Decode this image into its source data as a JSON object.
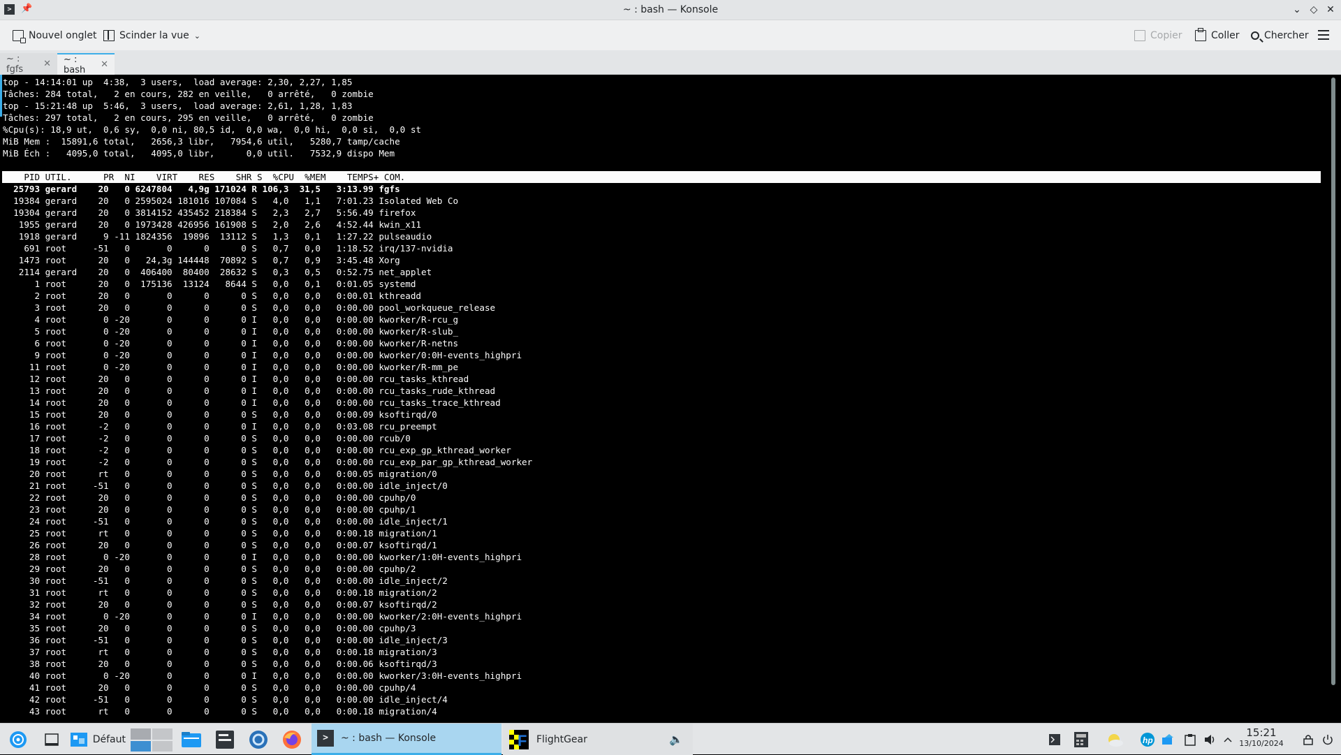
{
  "window": {
    "title": "~ : bash — Konsole",
    "title_icon": "terminal-icon",
    "buttons": [
      "minimize",
      "maximize",
      "close"
    ]
  },
  "toolbar": {
    "new_tab": "Nouvel onglet",
    "split_view": "Scinder la vue",
    "copy": "Copier",
    "paste": "Coller",
    "search": "Chercher",
    "menu_icon": "hamburger-menu-icon"
  },
  "tabs": [
    {
      "label": "~ : fgfs",
      "active": false
    },
    {
      "label": "~ : bash",
      "active": true
    }
  ],
  "terminal": {
    "summary": [
      "top - 14:14:01 up  4:38,  3 users,  load average: 2,30, 2,27, 1,85",
      "Tâches: 284 total,   2 en cours, 282 en veille,   0 arrêté,   0 zombie",
      "top - 15:21:48 up  5:46,  3 users,  load average: 2,61, 1,28, 1,83",
      "Tâches: 297 total,   2 en cours, 295 en veille,   0 arrêté,   0 zombie",
      "%Cpu(s): 18,9 ut,  0,6 sy,  0,0 ni, 80,5 id,  0,0 wa,  0,0 hi,  0,0 si,  0,0 st",
      "MiB Mem :  15891,6 total,   2656,3 libr,   7954,6 util,   5280,7 tamp/cache",
      "MiB Éch :   4095,0 total,   4095,0 libr,      0,0 util.   7532,9 dispo Mem",
      ""
    ],
    "header": "    PID UTIL.      PR  NI    VIRT    RES    SHR S  %CPU  %MEM    TEMPS+ COM.",
    "processes": [
      "  25793 gerard    20   0 6247804   4,9g 171024 R 106,3  31,5   3:13.99 fgfs",
      "  19384 gerard    20   0 2595024 181016 107084 S   4,0   1,1   7:01.23 Isolated Web Co",
      "  19304 gerard    20   0 3814152 435452 218384 S   2,3   2,7   5:56.49 firefox",
      "   1955 gerard    20   0 1973428 426956 161908 S   2,0   2,6   4:52.44 kwin_x11",
      "   1918 gerard     9 -11 1824356  19896  13112 S   1,3   0,1   1:27.22 pulseaudio",
      "    691 root     -51   0       0      0      0 S   0,7   0,0   1:18.52 irq/137-nvidia",
      "   1473 root      20   0   24,3g 144448  70892 S   0,7   0,9   3:45.48 Xorg",
      "   2114 gerard    20   0  406400  80400  28632 S   0,3   0,5   0:52.75 net_applet",
      "      1 root      20   0  175136  13124   8644 S   0,0   0,1   0:01.05 systemd",
      "      2 root      20   0       0      0      0 S   0,0   0,0   0:00.01 kthreadd",
      "      3 root      20   0       0      0      0 S   0,0   0,0   0:00.00 pool_workqueue_release",
      "      4 root       0 -20       0      0      0 I   0,0   0,0   0:00.00 kworker/R-rcu_g",
      "      5 root       0 -20       0      0      0 I   0,0   0,0   0:00.00 kworker/R-slub_",
      "      6 root       0 -20       0      0      0 I   0,0   0,0   0:00.00 kworker/R-netns",
      "      9 root       0 -20       0      0      0 I   0,0   0,0   0:00.00 kworker/0:0H-events_highpri",
      "     11 root       0 -20       0      0      0 I   0,0   0,0   0:00.00 kworker/R-mm_pe",
      "     12 root      20   0       0      0      0 I   0,0   0,0   0:00.00 rcu_tasks_kthread",
      "     13 root      20   0       0      0      0 I   0,0   0,0   0:00.00 rcu_tasks_rude_kthread",
      "     14 root      20   0       0      0      0 I   0,0   0,0   0:00.00 rcu_tasks_trace_kthread",
      "     15 root      20   0       0      0      0 S   0,0   0,0   0:00.09 ksoftirqd/0",
      "     16 root      -2   0       0      0      0 I   0,0   0,0   0:03.08 rcu_preempt",
      "     17 root      -2   0       0      0      0 S   0,0   0,0   0:00.00 rcub/0",
      "     18 root      -2   0       0      0      0 S   0,0   0,0   0:00.00 rcu_exp_gp_kthread_worker",
      "     19 root      -2   0       0      0      0 S   0,0   0,0   0:00.00 rcu_exp_par_gp_kthread_worker",
      "     20 root      rt   0       0      0      0 S   0,0   0,0   0:00.05 migration/0",
      "     21 root     -51   0       0      0      0 S   0,0   0,0   0:00.00 idle_inject/0",
      "     22 root      20   0       0      0      0 S   0,0   0,0   0:00.00 cpuhp/0",
      "     23 root      20   0       0      0      0 S   0,0   0,0   0:00.00 cpuhp/1",
      "     24 root     -51   0       0      0      0 S   0,0   0,0   0:00.00 idle_inject/1",
      "     25 root      rt   0       0      0      0 S   0,0   0,0   0:00.18 migration/1",
      "     26 root      20   0       0      0      0 S   0,0   0,0   0:00.07 ksoftirqd/1",
      "     28 root       0 -20       0      0      0 I   0,0   0,0   0:00.00 kworker/1:0H-events_highpri",
      "     29 root      20   0       0      0      0 S   0,0   0,0   0:00.00 cpuhp/2",
      "     30 root     -51   0       0      0      0 S   0,0   0,0   0:00.00 idle_inject/2",
      "     31 root      rt   0       0      0      0 S   0,0   0,0   0:00.18 migration/2",
      "     32 root      20   0       0      0      0 S   0,0   0,0   0:00.07 ksoftirqd/2",
      "     34 root       0 -20       0      0      0 I   0,0   0,0   0:00.00 kworker/2:0H-events_highpri",
      "     35 root      20   0       0      0      0 S   0,0   0,0   0:00.00 cpuhp/3",
      "     36 root     -51   0       0      0      0 S   0,0   0,0   0:00.00 idle_inject/3",
      "     37 root      rt   0       0      0      0 S   0,0   0,0   0:00.18 migration/3",
      "     38 root      20   0       0      0      0 S   0,0   0,0   0:00.06 ksoftirqd/3",
      "     40 root       0 -20       0      0      0 I   0,0   0,0   0:00.00 kworker/3:0H-events_highpri",
      "     41 root      20   0       0      0      0 S   0,0   0,0   0:00.00 cpuhp/4",
      "     42 root     -51   0       0      0      0 S   0,0   0,0   0:00.00 idle_inject/4",
      "     43 root      rt   0       0      0      0 S   0,0   0,0   0:00.18 migration/4"
    ]
  },
  "taskbar": {
    "launcher_icon": "app-launcher-icon",
    "desktop": "Défaut",
    "tasks": [
      {
        "label": "~ : bash — Konsole",
        "icon": "terminal-icon",
        "active": true
      },
      {
        "label": "FlightGear",
        "icon": "flightgear-icon",
        "active": false
      }
    ],
    "clock_time": "15:21",
    "clock_date": "13/10/2024"
  },
  "colors": {
    "accent": "#3daee9",
    "terminal_bg": "#000000",
    "terminal_fg": "#fcfcfc"
  }
}
